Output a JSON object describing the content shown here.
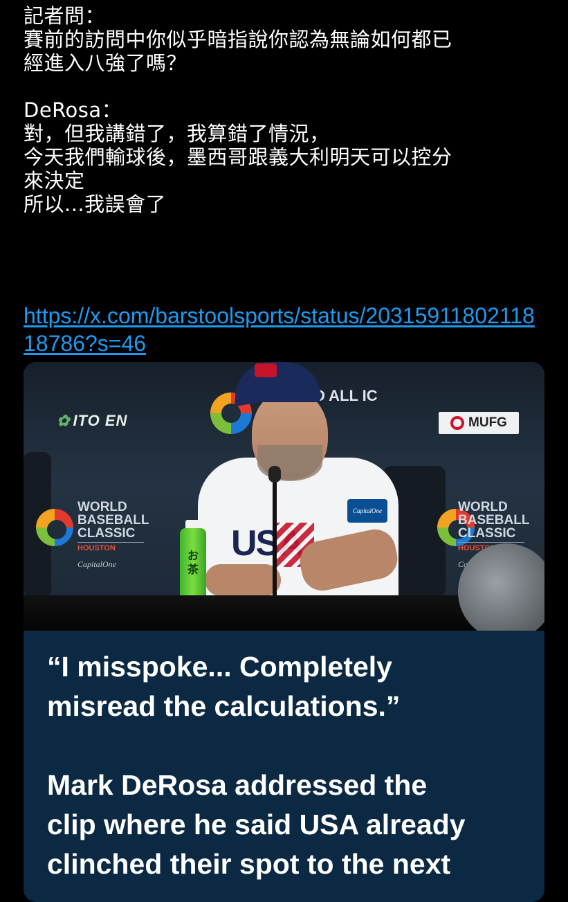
{
  "post": {
    "lines": [
      "記者問：",
      "賽前的訪問中你似乎暗指說你認為無論如何都已",
      "經進入八強了嗎？",
      "",
      "DeRosa：",
      "對，但我講錯了，我算錯了情況，",
      "今天我們輸球後，墨西哥跟義大利明天可以控分",
      "來決定",
      "所以...我誤會了"
    ],
    "link": "https://x.com/barstoolsports/status/2031591180211818786?s=46"
  },
  "card": {
    "media": {
      "sponsor_left": "ITO EN",
      "sponsor_right": "MUFG",
      "wbc_title": "WORLD BASEBALL CLASSIC",
      "wbc_lines": [
        "WORLD",
        "BASEBALL",
        "CLASSIC"
      ],
      "wbc_city": "HOUSTON",
      "wbc_sponsor": "CapitalOne",
      "backdrop_partial": "D ALL IC",
      "jersey_text": "USA",
      "bottle_label": "お茶"
    },
    "quote_lines": [
      "“I misspoke... Completely",
      "misread the calculations.”",
      "",
      "Mark DeRosa addressed the",
      "clip where he said USA already",
      "clinched their spot to the next"
    ]
  },
  "colors": {
    "background": "#000000",
    "link": "#1d9bf0",
    "card_caption_bg": "#0b2943",
    "text": "#ffffff"
  }
}
